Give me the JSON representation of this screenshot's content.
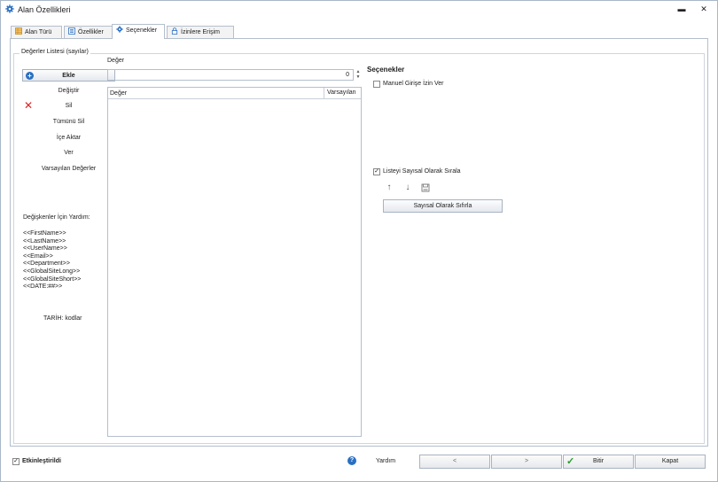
{
  "window": {
    "title": "Alan Özellikleri",
    "minimize_glyph": "▬",
    "close_glyph": "✕"
  },
  "tabs": [
    {
      "label": "Alan Türü",
      "icon": "table-icon"
    },
    {
      "label": "Özellikler",
      "icon": "properties-icon"
    },
    {
      "label": "Seçenekler",
      "icon": "gear-icon"
    },
    {
      "label": "İzinlere Erişim",
      "icon": "lock-icon"
    }
  ],
  "values_group": {
    "legend": "Değerler Listesi (sayılar)",
    "buttons": {
      "add": "Ekle",
      "edit": "Değiştir",
      "delete": "Sil",
      "delete_all": "Tümünü Sil",
      "import": "İçe Aktar",
      "export": "Ver",
      "defaults": "Varsayılan Değerler"
    },
    "help_title": "Değişkenler İçin Yardım:",
    "variables": [
      "<<FirstName>>",
      "<<LastName>>",
      "<<UserName>>",
      "<<Email>>",
      "<<Department>>",
      "<<GlobalSiteLong>>",
      "<<GlobalSiteShort>>",
      "<<DATE:##>>"
    ],
    "date_codes": "TARİH: kodlar"
  },
  "value_input": {
    "label": "Değer",
    "value": "0"
  },
  "grid": {
    "columns": [
      "Değer",
      "Varsayılan"
    ]
  },
  "options": {
    "title": "Seçenekler",
    "manual_entry": {
      "label": "Manuel Girişe İzin Ver",
      "checked": false
    },
    "sort_numeric": {
      "label": "Listeyi Sayısal Olarak Sırala",
      "checked": true
    },
    "reset_button": "Sayısal Olarak Sıfırla"
  },
  "footer": {
    "enabled": {
      "label": "Etkinleştirildi",
      "checked": true
    },
    "help": "Yardım",
    "back": "<",
    "next": ">",
    "finish": "Bitir",
    "close": "Kapat"
  },
  "colors": {
    "accent_blue": "#2a6fc1",
    "delete_red": "#d22222",
    "finish_green": "#2a9d2a"
  }
}
